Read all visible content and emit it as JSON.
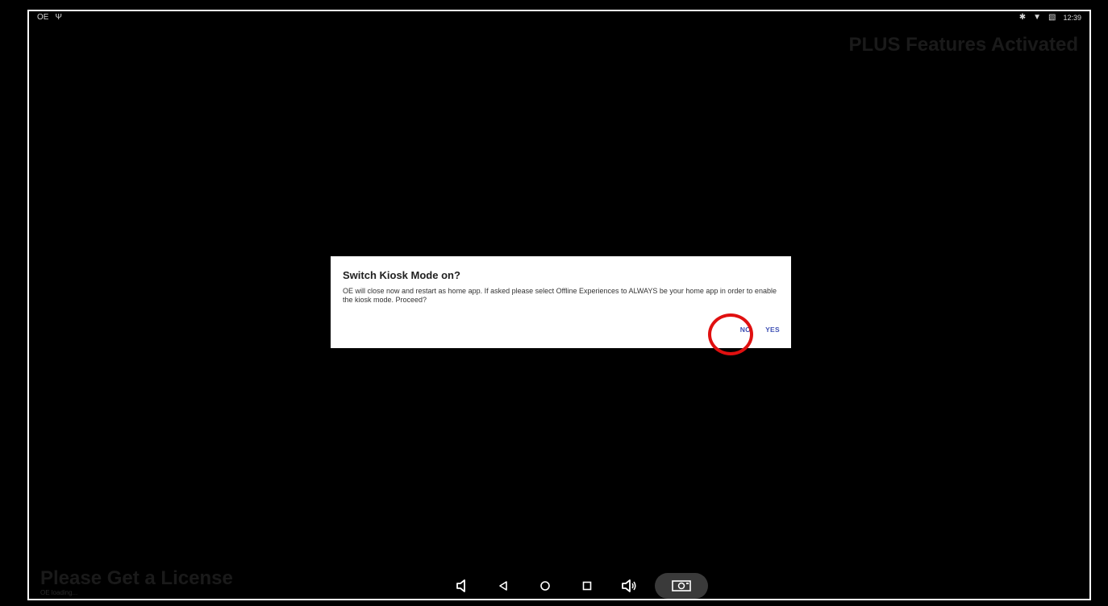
{
  "statusbar": {
    "left_icons": [
      "oe-app-icon",
      "usb-icon"
    ],
    "left_label": "OE",
    "right_icons": [
      "bluetooth-icon",
      "wifi-icon",
      "no-sim-icon"
    ],
    "time": "12:39"
  },
  "banner": {
    "text": "PLUS Features Activated"
  },
  "footer": {
    "license_text": "Please Get a License",
    "loading_text": "OE loading..."
  },
  "dialog": {
    "title": "Switch Kiosk Mode on?",
    "message": "OE will close now and restart as home app. If asked please select Offline Experiences to ALWAYS be your home app in order to enable the kiosk mode. Proceed?",
    "no_label": "NO",
    "yes_label": "YES"
  },
  "navbar": {
    "items": [
      "volume-down-icon",
      "back-icon",
      "home-icon",
      "recents-icon",
      "volume-up-icon",
      "screenshot-icon"
    ]
  },
  "colors": {
    "accent": "#3f51b5",
    "annotation": "#e01010"
  }
}
